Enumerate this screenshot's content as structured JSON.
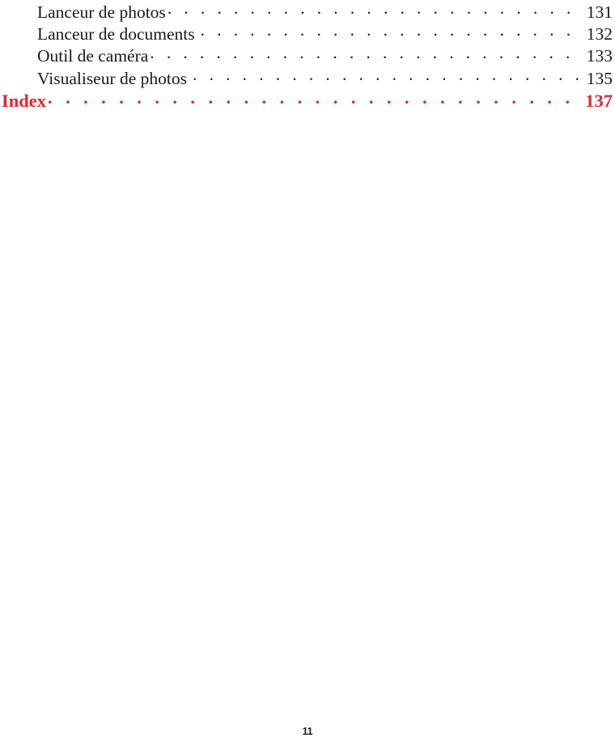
{
  "document": {
    "type": "table-of-contents",
    "language": "fr",
    "background_color": "#ffffff",
    "text_color": "#1a1a1a",
    "accent_color": "#e3262b"
  },
  "toc": {
    "entries": [
      {
        "title": "Lanceur de photos",
        "space_before_leader": false,
        "leader": ". . . . . . . . . . . . . . . . . . . . . . . . . . . . . . . . . . . . . . . . . . . . . . . . . . . . . . .",
        "page": "131",
        "level": 2,
        "color": "#1a1a1a"
      },
      {
        "title": "Lanceur de documents",
        "space_before_leader": true,
        "leader": ". . . . . . . . . . . . . . . . . . . . . . . . . . . . . . . . . . . . . . . . . . . . . . . . . . . . . . .",
        "page": "132",
        "level": 2,
        "color": "#1a1a1a"
      },
      {
        "title": "Outil de caméra",
        "space_before_leader": false,
        "leader": ". . . . . . . . . . . . . . . . . . . . . . . . . . . . . . . . . . . . . . . . . . . . . . . . . . . . . . .",
        "page": "133",
        "level": 2,
        "color": "#1a1a1a"
      },
      {
        "title": "Visualiseur de photos",
        "space_before_leader": true,
        "leader": ". . . . . . . . . . . . . . . . . . . . . . . . . . . . . . . . . . . . . . . . . . . . . . . . . . . . . . .",
        "page": "135",
        "level": 2,
        "color": "#1a1a1a"
      },
      {
        "title": "Index",
        "space_before_leader": false,
        "leader": ". . . . . . . . . . . . . . . . . . . . . . . . . . . . . . . . . . . . . . . . . . . . . . . . . . . . . . .",
        "page": "137",
        "level": 1,
        "color": "#e3262b"
      }
    ]
  },
  "footer": {
    "page_number": "11"
  }
}
